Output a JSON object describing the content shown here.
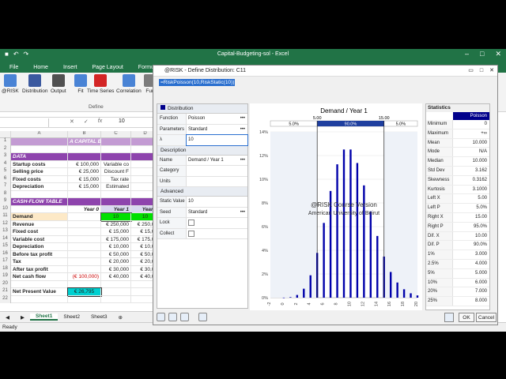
{
  "excel": {
    "title": "Capital-Budgeting-sol - Excel",
    "menu": [
      "File",
      "Home",
      "Insert",
      "Page Layout",
      "Formu"
    ],
    "ribbon": [
      {
        "label": "@RISK",
        "icon": "risk-icon"
      },
      {
        "label": "Distribution",
        "icon": "distribution-icon"
      },
      {
        "label": "Output",
        "icon": "output-icon"
      },
      {
        "label": "Fit",
        "icon": "fit-icon"
      },
      {
        "label": "Time Series",
        "icon": "timeseries-icon"
      },
      {
        "label": "Correlation",
        "icon": "correlation-icon"
      },
      {
        "label": "Fun",
        "icon": "function-icon"
      }
    ],
    "ribbon_group": "Define",
    "formula_value": "10",
    "col_headers": [
      "A",
      "B",
      "C",
      "D"
    ],
    "rows": [
      {
        "n": "1",
        "cells": [
          "",
          "A CAPITAL BUDGETING EXAMP",
          "",
          ""
        ],
        "style": "title"
      },
      {
        "n": "2",
        "cells": [
          "",
          "",
          "",
          ""
        ]
      },
      {
        "n": "3",
        "cells": [
          "DATA",
          "",
          "",
          ""
        ],
        "style": "section"
      },
      {
        "n": "4",
        "cells": [
          "Startup costs",
          "€ 100,000",
          "Variable co",
          ""
        ]
      },
      {
        "n": "5",
        "cells": [
          "Selling price",
          "€ 25,000",
          "Discount F",
          ""
        ]
      },
      {
        "n": "6",
        "cells": [
          "Fixed costs",
          "€ 15,000",
          "Tax rate",
          ""
        ]
      },
      {
        "n": "7",
        "cells": [
          "Depreciation",
          "€ 15,000",
          "Estimated",
          ""
        ]
      },
      {
        "n": "8",
        "cells": [
          "",
          "",
          "",
          ""
        ]
      },
      {
        "n": "9",
        "cells": [
          "CASH-FLOW TABLE",
          "",
          "",
          ""
        ],
        "style": "section"
      },
      {
        "n": "10",
        "cells": [
          "",
          "Year 0",
          "Year 1",
          "Year 2"
        ],
        "style": "header"
      },
      {
        "n": "11",
        "cells": [
          "Demand",
          "",
          "10",
          "10"
        ],
        "style": "demand"
      },
      {
        "n": "12",
        "cells": [
          "Revenue",
          "",
          "€ 250,000",
          "€ 250,00"
        ]
      },
      {
        "n": "13",
        "cells": [
          "Fixed cost",
          "",
          "€ 15,000",
          "€ 15,00"
        ]
      },
      {
        "n": "14",
        "cells": [
          "Variable cost",
          "",
          "€ 175,000",
          "€ 175,00"
        ]
      },
      {
        "n": "15",
        "cells": [
          "Depreciation",
          "",
          "€ 10,000",
          "€ 10,00"
        ]
      },
      {
        "n": "16",
        "cells": [
          "Before tax profit",
          "",
          "€ 50,000",
          "€ 50,00"
        ]
      },
      {
        "n": "17",
        "cells": [
          "Tax",
          "",
          "€ 20,000",
          "€ 20,00"
        ]
      },
      {
        "n": "18",
        "cells": [
          "After tax profit",
          "",
          "€ 30,000",
          "€ 30,00"
        ]
      },
      {
        "n": "19",
        "cells": [
          "Net cash flow",
          "(€ 100,000)",
          "€ 40,000",
          "€ 40,00"
        ],
        "style": "ncf"
      },
      {
        "n": "20",
        "cells": [
          "",
          "",
          "",
          ""
        ]
      },
      {
        "n": "21",
        "cells": [
          "Net Present Value",
          "€ 26,795",
          "",
          ""
        ],
        "style": "npv"
      },
      {
        "n": "22",
        "cells": [
          "",
          "",
          "",
          ""
        ]
      }
    ],
    "sheet_tabs": [
      "Sheet1",
      "Sheet2",
      "Sheet3"
    ],
    "status": "Ready"
  },
  "dialog": {
    "title": "@RISK - Define Distribution: C11",
    "formula": "=RiskPoisson(10,RiskStatic(10))",
    "props_header": "Distribution",
    "props": [
      {
        "k": "Function",
        "v": "Poisson",
        "dots": true
      },
      {
        "k": "Parameters",
        "v": "Standard",
        "dots": true
      },
      {
        "k": "λ",
        "v": "10",
        "highlight": true
      },
      {
        "k": "Description",
        "v": "",
        "header": true
      },
      {
        "k": "Name",
        "v": "Demand / Year 1",
        "dots": true
      },
      {
        "k": "Category",
        "v": ""
      },
      {
        "k": "Units",
        "v": ""
      },
      {
        "k": "Advanced",
        "v": "",
        "header": true
      },
      {
        "k": "Static Value",
        "v": "10"
      },
      {
        "k": "Seed",
        "v": "Standard",
        "dots": true
      },
      {
        "k": "Lock",
        "v": "",
        "check": true
      },
      {
        "k": "Collect",
        "v": "",
        "check": true
      }
    ],
    "stats_title": "Statistics",
    "stats_series": "Poisson",
    "stats": [
      [
        "Minimum",
        "0"
      ],
      [
        "Maximum",
        "+∞"
      ],
      [
        "Mean",
        "10.000"
      ],
      [
        "Mode",
        "N/A"
      ],
      [
        "Median",
        "10.000"
      ],
      [
        "Std Dev",
        "3.162"
      ],
      [
        "Skewness",
        "0.3162"
      ],
      [
        "Kurtosis",
        "3.1000"
      ],
      [
        "Left X",
        "5.00"
      ],
      [
        "Left P",
        "5.0%"
      ],
      [
        "Right X",
        "15.00"
      ],
      [
        "Right P",
        "95.0%"
      ],
      [
        "Dif. X",
        "10.00"
      ],
      [
        "Dif. P",
        "90.0%"
      ],
      [
        "1%",
        "3.000"
      ],
      [
        "2.5%",
        "4.000"
      ],
      [
        "5%",
        "5.000"
      ],
      [
        "10%",
        "6.000"
      ],
      [
        "20%",
        "7.000"
      ],
      [
        "25%",
        "8.000"
      ]
    ],
    "ok": "OK",
    "cancel": "Cancel"
  },
  "chart_data": {
    "type": "bar",
    "title": "Demand / Year 1",
    "watermark": "@RISK Course Version",
    "watermark2": "American University of Beirut",
    "x": [
      0,
      1,
      2,
      3,
      4,
      5,
      6,
      7,
      8,
      9,
      10,
      11,
      12,
      13,
      14,
      15,
      16,
      17,
      18,
      19,
      20
    ],
    "values": [
      4.54e-05,
      0.000454,
      0.00227,
      0.00757,
      0.0189,
      0.0378,
      0.0631,
      0.0901,
      0.1126,
      0.1251,
      0.1251,
      0.1137,
      0.0948,
      0.0729,
      0.0521,
      0.0347,
      0.0217,
      0.0128,
      0.0071,
      0.0037,
      0.0019
    ],
    "xlim": [
      -2,
      20
    ],
    "ylim": [
      0,
      14
    ],
    "y_ticks": [
      "0%",
      "2%",
      "4%",
      "6%",
      "8%",
      "10%",
      "12%",
      "14%"
    ],
    "x_ticks": [
      "-2",
      "0",
      "2",
      "4",
      "6",
      "8",
      "10",
      "12",
      "14",
      "16",
      "18",
      "20"
    ],
    "left_x": "5.00",
    "right_x": "15.00",
    "left_p": "5.0%",
    "mid_p": "90.0%",
    "right_p": "5.0%",
    "bar_color": "#0000aa"
  }
}
